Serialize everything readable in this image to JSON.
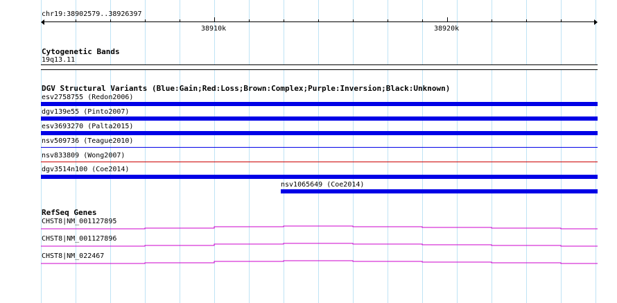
{
  "ruler": {
    "region": "chr19:38902579..38926397",
    "ticks": [
      "38910k",
      "38920k"
    ]
  },
  "cytobands": {
    "title": "Cytogenetic Bands",
    "band": "19q13.11"
  },
  "dgv": {
    "title": "DGV Structural Variants (Blue:Gain;Red:Loss;Brown:Complex;Purple:Inversion;Black:Unknown)",
    "variants": [
      {
        "label": "esv2758755 (Redon2006)",
        "color": "#0000e6",
        "thickness": "thick"
      },
      {
        "label": "dgv139e55 (Pinto2007)",
        "color": "#0000e6",
        "thickness": "thick"
      },
      {
        "label": "esv3693270 (Palta2015)",
        "color": "#0000e6",
        "thickness": "thick"
      },
      {
        "label": "nsv509736 (Teague2010)",
        "color": "#0000e6",
        "thickness": "thin"
      },
      {
        "label": "nsv833809 (Wong2007)",
        "color": "#cc0000",
        "thickness": "thin"
      },
      {
        "label": "dgv3514n100 (Coe2014)",
        "color": "#0000e6",
        "thickness": "thick"
      },
      {
        "label": "nsv1065649 (Coe2014)",
        "color": "#0000e6",
        "thickness": "thick"
      }
    ]
  },
  "refseq": {
    "title": "RefSeq Genes",
    "genes": [
      {
        "label": "CHST8|NM_001127895",
        "color": "#cc00cc"
      },
      {
        "label": "CHST8|NM_001127896",
        "color": "#cc00cc"
      },
      {
        "label": "CHST8|NM_022467",
        "color": "#cc00cc"
      }
    ]
  }
}
